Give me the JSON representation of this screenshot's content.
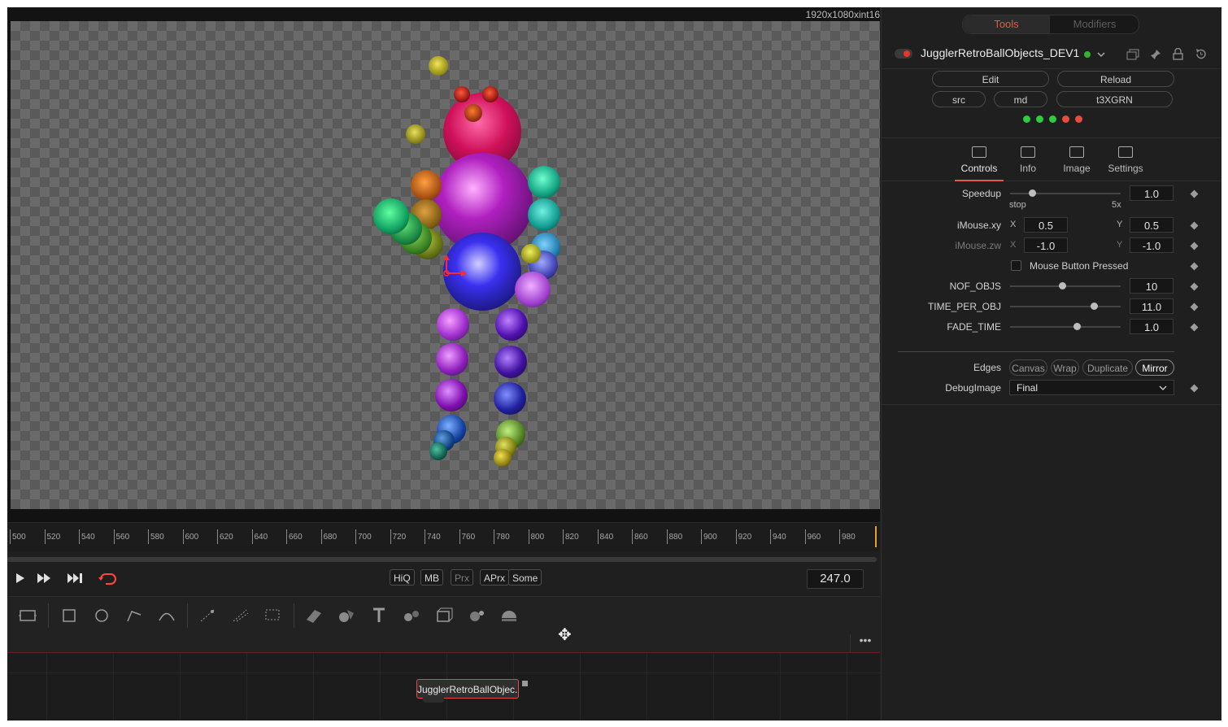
{
  "viewer": {
    "resolution": "1920x1080xint16"
  },
  "ruler": {
    "ticks": [
      "500",
      "520",
      "540",
      "560",
      "580",
      "600",
      "620",
      "640",
      "660",
      "680",
      "700",
      "720",
      "740",
      "760",
      "780",
      "800",
      "820",
      "840",
      "860",
      "880",
      "900",
      "920",
      "940",
      "960",
      "980"
    ]
  },
  "transport": {
    "play_icon": "play-icon",
    "ff_icon": "fast-forward-icon",
    "end_icon": "skip-to-end-icon",
    "loop_icon": "loop-icon",
    "quality_buttons": [
      "HiQ",
      "MB",
      "Prx",
      "APrx",
      "Some"
    ],
    "current_frame": "247.0"
  },
  "node": {
    "label": "JugglerRetroBallObjec..."
  },
  "inspector": {
    "tabs": {
      "tools": "Tools",
      "modifiers": "Modifiers"
    },
    "tool_name": "JugglerRetroBallObjects_DEV1",
    "buttons": {
      "edit": "Edit",
      "reload": "Reload",
      "src": "src",
      "md": "md",
      "t3xgrn": "t3XGRN"
    },
    "status_dots": [
      "#2ecc40",
      "#2ecc40",
      "#2ecc40",
      "#e74c3c",
      "#e74c3c"
    ],
    "subtabs": [
      "Controls",
      "Info",
      "Image",
      "Settings"
    ],
    "params": {
      "speedup": {
        "label": "Speedup",
        "value": "1.0",
        "min_label": "stop",
        "max_label": "5x",
        "level": 0.2
      },
      "imouse_xy": {
        "label": "iMouse.xy",
        "x_label": "X",
        "x": "0.5",
        "y_label": "Y",
        "y": "0.5"
      },
      "imouse_zw": {
        "label": "iMouse.zw",
        "x_label": "X",
        "x": "-1.0",
        "y_label": "Y",
        "y": "-1.0"
      },
      "mouse_button": {
        "label": "Mouse Button Pressed",
        "checked": false
      },
      "nof_objs": {
        "label": "NOF_OBJS",
        "value": "10",
        "level": 0.47
      },
      "time_per_obj": {
        "label": "TIME_PER_OBJ",
        "value": "11.0",
        "level": 0.76
      },
      "fade_time": {
        "label": "FADE_TIME",
        "value": "1.0",
        "level": 0.6
      },
      "edges": {
        "label": "Edges",
        "options": [
          "Canvas",
          "Wrap",
          "Duplicate",
          "Mirror"
        ],
        "selected": "Mirror"
      },
      "debug_image": {
        "label": "DebugImage",
        "value": "Final"
      }
    }
  },
  "colors": {
    "accent": "#e05a4c",
    "panel": "#1f1f1f"
  }
}
